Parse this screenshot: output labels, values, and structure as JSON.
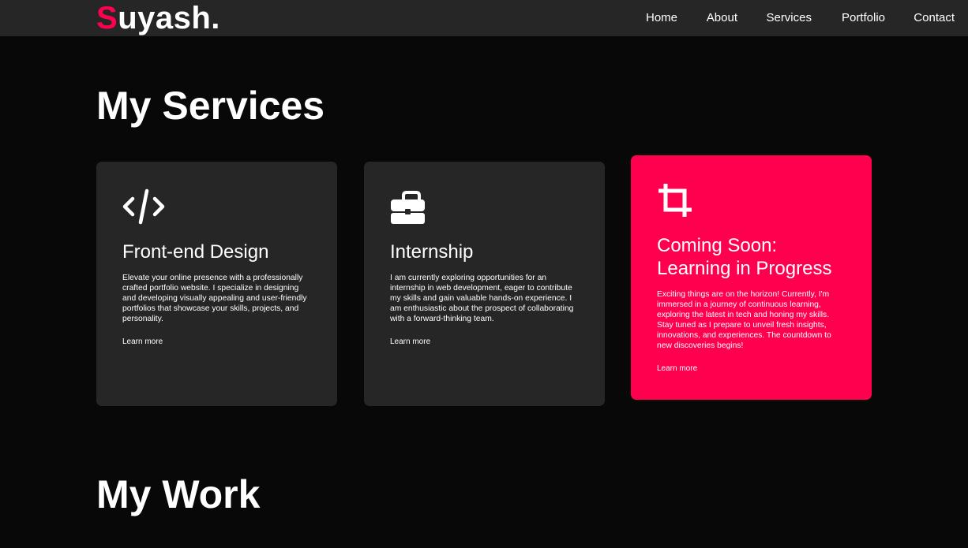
{
  "header": {
    "logo_accent": "S",
    "logo_rest": "uyash.",
    "nav": [
      "Home",
      "About",
      "Services",
      "Portfolio",
      "Contact"
    ]
  },
  "services": {
    "title": "My Services",
    "cards": [
      {
        "icon": "code-icon",
        "title": "Front-end Design",
        "description": "Elevate your online presence with a professionally crafted portfolio website. I specialize in designing and developing visually appealing and user-friendly portfolios that showcase your skills, projects, and personality.",
        "link": "Learn more"
      },
      {
        "icon": "briefcase-icon",
        "title": "Internship",
        "description": "I am currently exploring opportunities for an internship in web development, eager to contribute my skills and gain valuable hands-on experience. I am enthusiastic about the prospect of collaborating with a forward-thinking team.",
        "link": "Learn more"
      },
      {
        "icon": "crop-icon",
        "title": "Coming Soon: Learning in Progress",
        "description": "Exciting things are on the horizon! Currently, I'm immersed in a journey of continuous learning, exploring the latest in tech and honing my skills. Stay tuned as I prepare to unveil fresh insights, innovations, and experiences. The countdown to new discoveries begins!",
        "link": "Learn more"
      }
    ]
  },
  "work": {
    "title": "My Work"
  },
  "colors": {
    "accent": "#ff004f",
    "background": "#080808",
    "card": "#262626",
    "navbar": "#262626"
  }
}
